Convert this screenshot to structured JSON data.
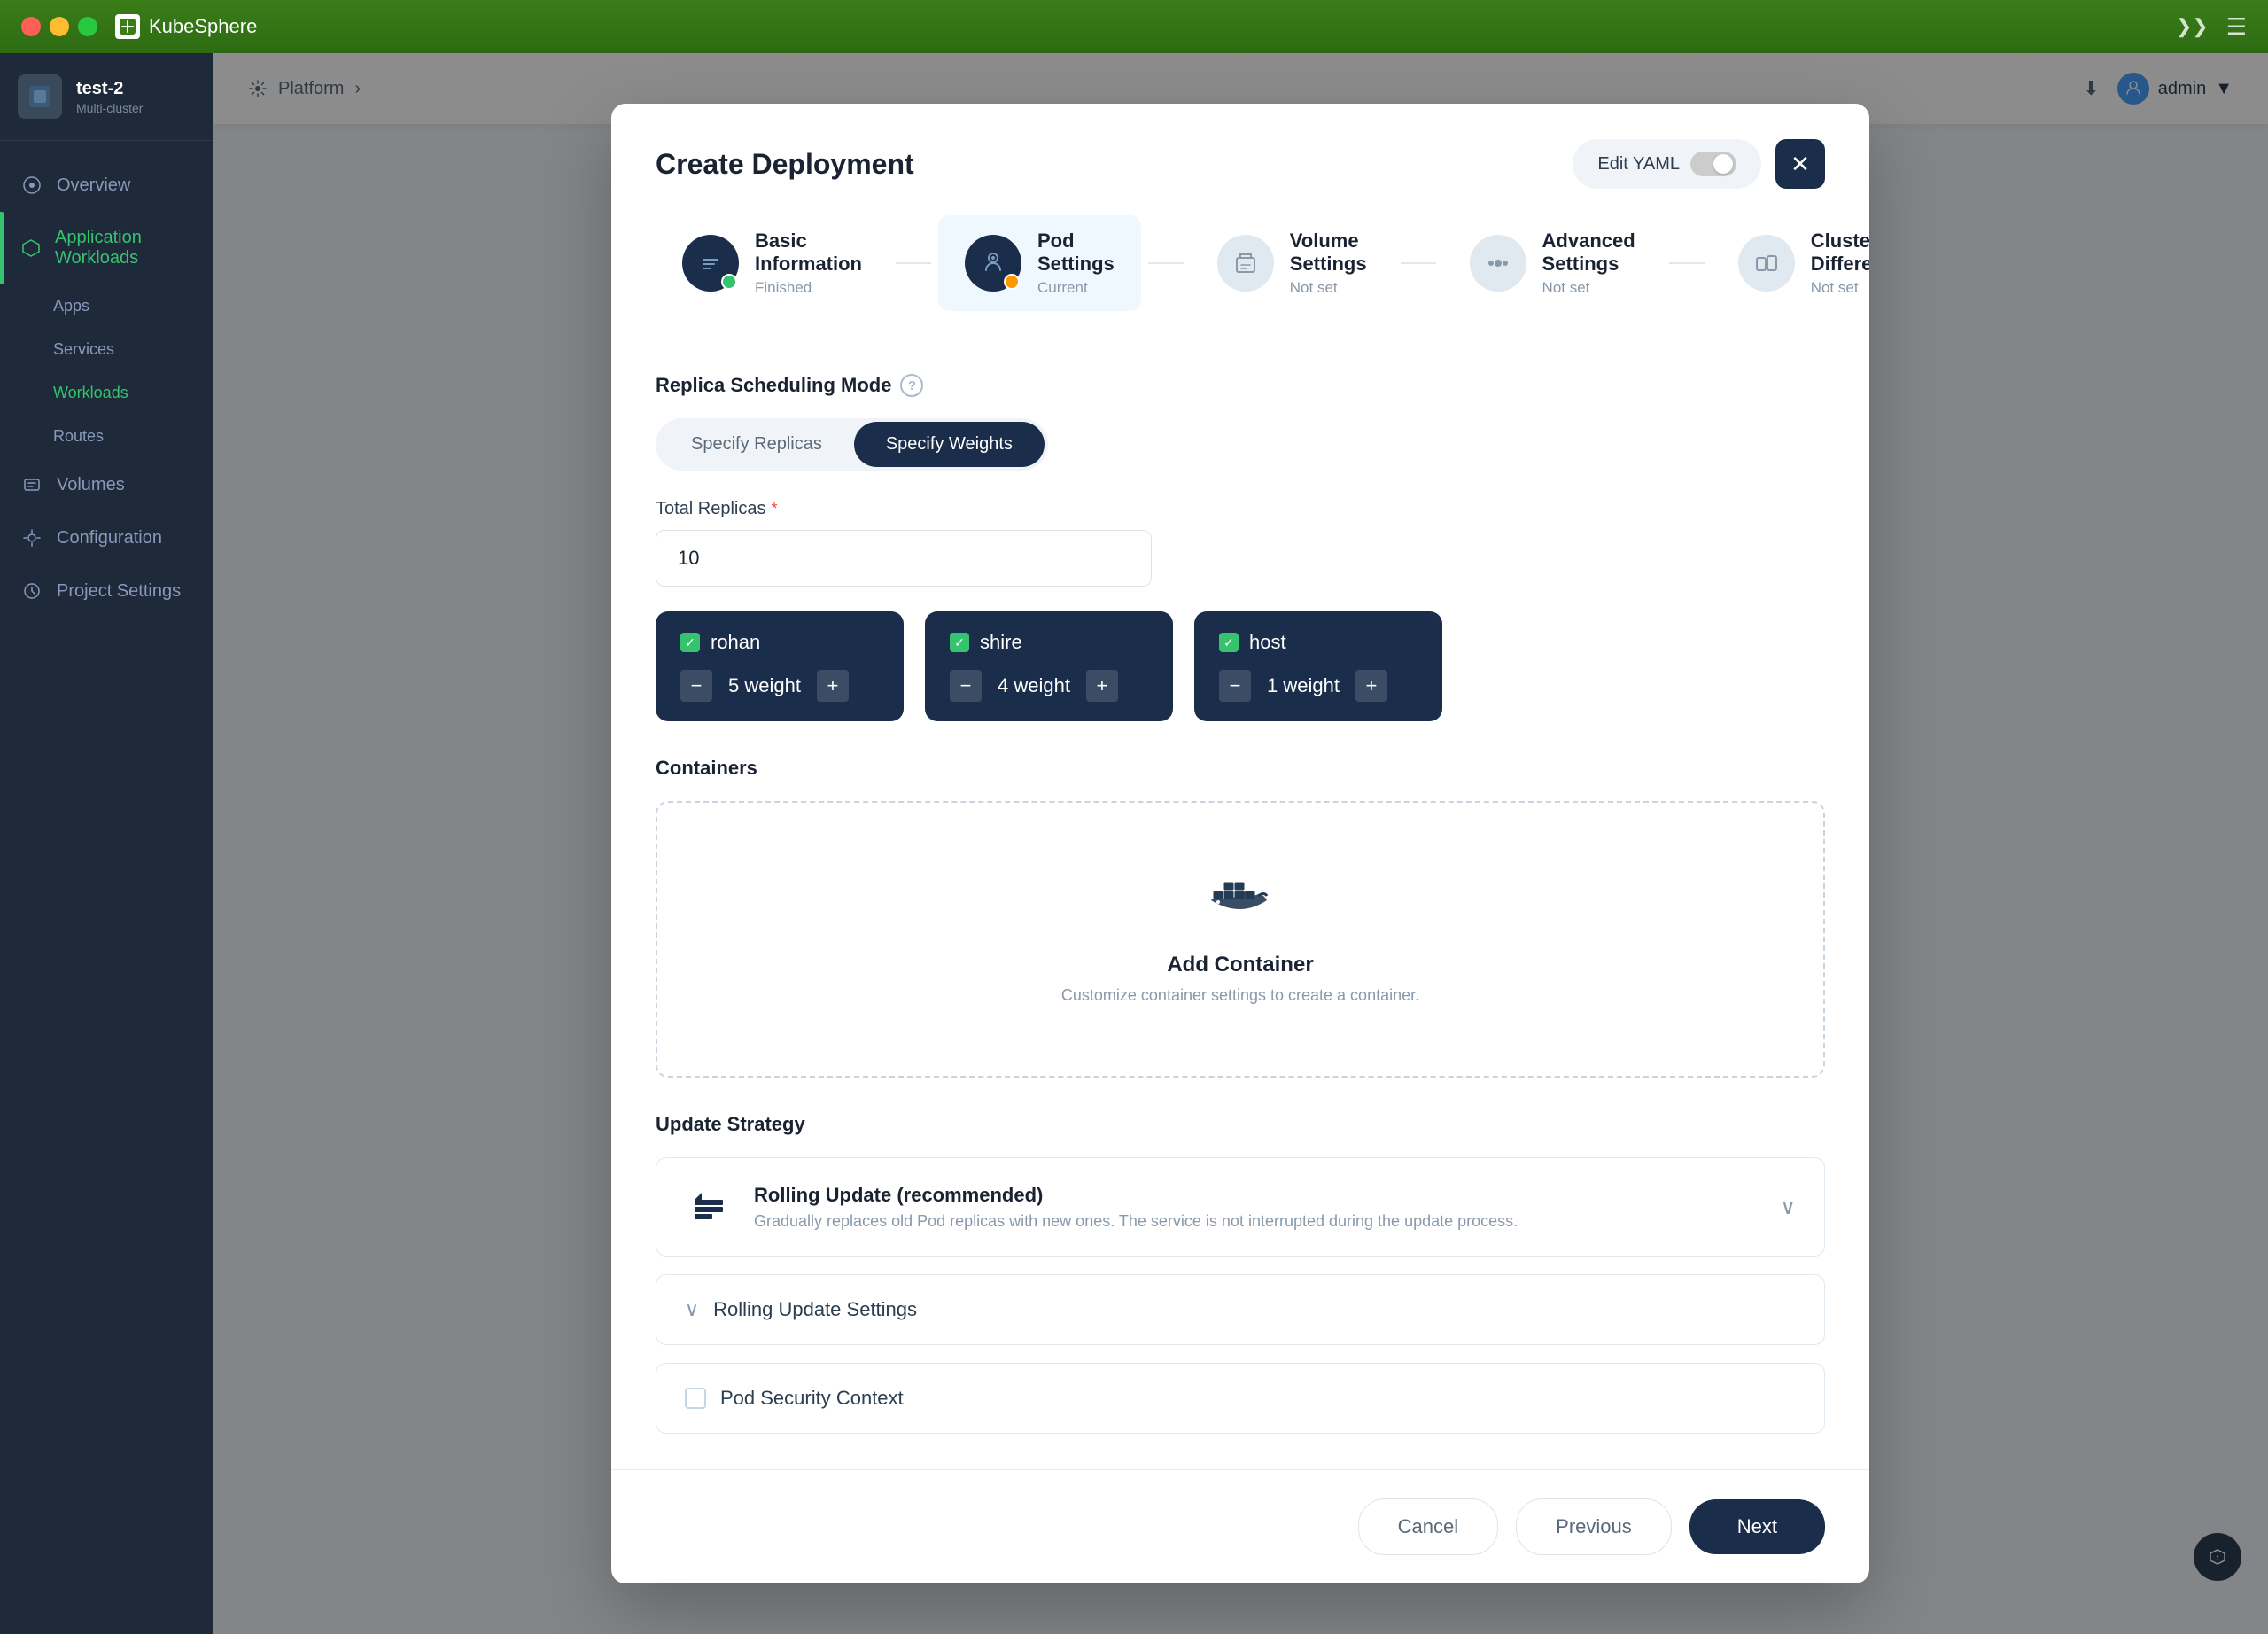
{
  "titlebar": {
    "app_name": "KubeSphere",
    "dots": [
      "red",
      "yellow",
      "green"
    ],
    "more_icon": "❯❯",
    "menu_icon": "☰"
  },
  "topbar": {
    "breadcrumb": "Platform",
    "user": "admin",
    "chevron": "▼",
    "download_icon": "⬇"
  },
  "sidebar": {
    "workspace_name": "test-2",
    "workspace_desc": "Multi-cluster",
    "items": [
      {
        "label": "Overview",
        "icon": "⊙",
        "active": false
      },
      {
        "label": "Application Workloads",
        "icon": "⚡",
        "active": true
      },
      {
        "label": "Apps",
        "sublabel": "",
        "sub": true,
        "active": false
      },
      {
        "label": "Services",
        "sublabel": "",
        "sub": true,
        "active": false
      },
      {
        "label": "Workloads",
        "sublabel": "",
        "sub": true,
        "active": true
      },
      {
        "label": "Routes",
        "sublabel": "",
        "sub": true,
        "active": false
      },
      {
        "label": "Volumes",
        "icon": "💾",
        "active": false
      },
      {
        "label": "Configuration",
        "icon": "✏",
        "active": false
      },
      {
        "label": "Project Settings",
        "icon": "⚙",
        "active": false
      }
    ]
  },
  "modal": {
    "title": "Create Deployment",
    "edit_yaml_label": "Edit YAML",
    "close_label": "✕",
    "steps": [
      {
        "name": "Basic Information",
        "status": "Finished",
        "state": "finished"
      },
      {
        "name": "Pod Settings",
        "status": "Current",
        "state": "current"
      },
      {
        "name": "Volume Settings",
        "status": "Not set",
        "state": "notset"
      },
      {
        "name": "Advanced Settings",
        "status": "Not set",
        "state": "notset"
      },
      {
        "name": "Cluster Differences",
        "status": "Not set",
        "state": "notset"
      }
    ],
    "replica_scheduling": {
      "label": "Replica Scheduling Mode",
      "options": [
        {
          "label": "Specify Replicas",
          "active": false
        },
        {
          "label": "Specify Weights",
          "active": true
        }
      ]
    },
    "total_replicas": {
      "label": "Total Replicas",
      "required": true,
      "value": "10"
    },
    "clusters": [
      {
        "name": "rohan",
        "weight": 5
      },
      {
        "name": "shire",
        "weight": 4
      },
      {
        "name": "host",
        "weight": 1
      }
    ],
    "containers": {
      "section_label": "Containers",
      "empty_title": "Add Container",
      "empty_desc": "Customize container settings to create a container."
    },
    "update_strategy": {
      "section_label": "Update Strategy",
      "name": "Rolling Update (recommended)",
      "desc": "Gradually replaces old Pod replicas with new ones. The service is not interrupted during the update process."
    },
    "rolling_settings_label": "Rolling Update Settings",
    "pod_security_label": "Pod Security Context",
    "footer": {
      "cancel_label": "Cancel",
      "previous_label": "Previous",
      "next_label": "Next"
    }
  }
}
